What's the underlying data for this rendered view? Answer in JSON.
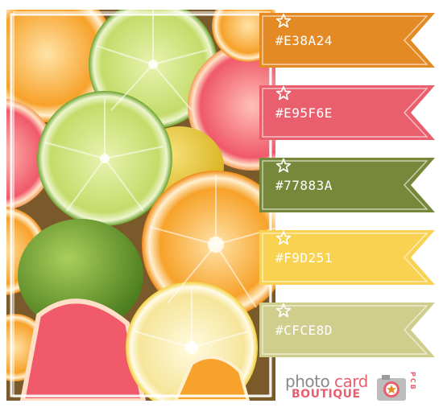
{
  "swatches": [
    {
      "hex": "#E38A24",
      "color": "#E38A24"
    },
    {
      "hex": "#E95F6E",
      "color": "#E95F6E"
    },
    {
      "hex": "#77883A",
      "color": "#77883A"
    },
    {
      "hex": "#F9D251",
      "color": "#F9D251"
    },
    {
      "hex": "#CFCE8D",
      "color": "#CFCE8D"
    }
  ],
  "brand": {
    "word_photo": "photo",
    "word_card": "card",
    "word_boutique": "BOUTIQUE",
    "initials": "PCB"
  },
  "icons": {
    "swatch_marker": "star-icon",
    "logo_camera": "camera-icon"
  }
}
